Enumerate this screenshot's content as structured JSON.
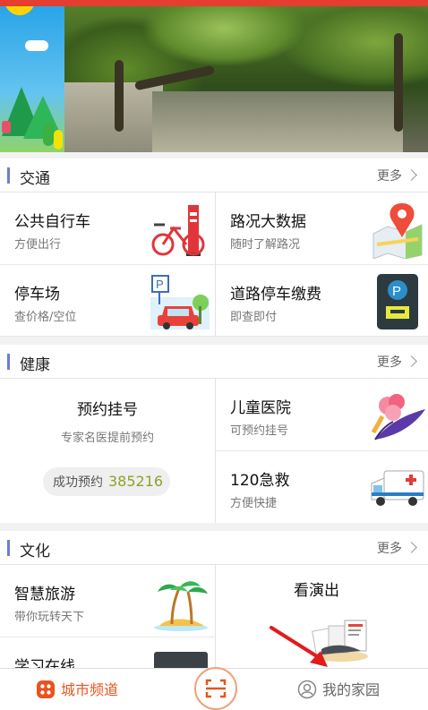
{
  "sections": {
    "traffic": {
      "title": "交通",
      "more": "更多",
      "items": [
        {
          "name": "公共自行车",
          "sub": "方便出行"
        },
        {
          "name": "路况大数据",
          "sub": "随时了解路况"
        },
        {
          "name": "停车场",
          "sub": "查价格/空位"
        },
        {
          "name": "道路停车缴费",
          "sub": "即查即付"
        }
      ]
    },
    "health": {
      "title": "健康",
      "more": "更多",
      "appointment": {
        "name": "预约挂号",
        "sub": "专家名医提前预约",
        "success_label": "成功预约",
        "success_count": "385216"
      },
      "items": [
        {
          "name": "儿童医院",
          "sub": "可预约挂号"
        },
        {
          "name": "120急救",
          "sub": "方便快捷"
        }
      ]
    },
    "culture": {
      "title": "文化",
      "more": "更多",
      "items": [
        {
          "name": "智慧旅游",
          "sub": "带你玩转天下"
        },
        {
          "name": "看演出"
        },
        {
          "name": "学习在线"
        }
      ]
    }
  },
  "tabbar": {
    "left_label": "城市频道",
    "right_label": "我的家园"
  },
  "colors": {
    "accent": "#e8541e",
    "section_bar": "#6b7fd6",
    "success_number": "#8aa32a",
    "top_bar": "#e53d30"
  },
  "icons": [
    "chevron-right-icon",
    "bicycle-icon",
    "map-pin-icon",
    "parking-car-icon",
    "parking-meter-icon",
    "flower-icon",
    "ambulance-icon",
    "palm-island-icon",
    "performance-icon",
    "city-channel-icon",
    "scan-icon",
    "my-home-icon"
  ]
}
